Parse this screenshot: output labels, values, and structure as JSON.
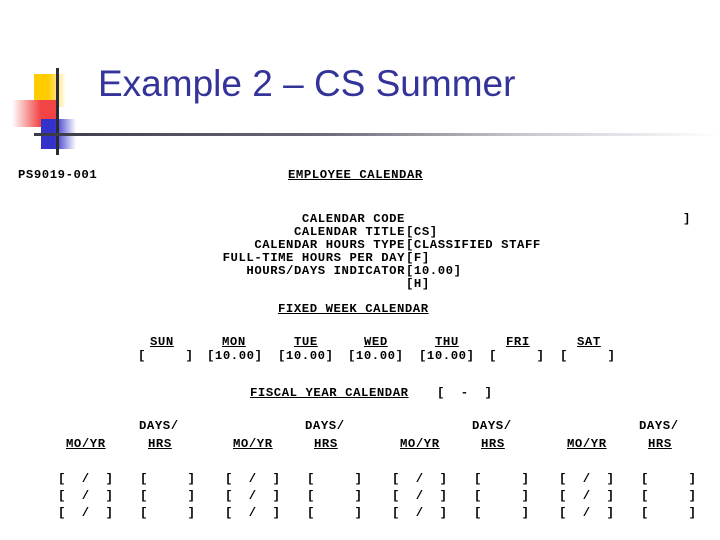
{
  "slide": {
    "title": "Example 2 – CS Summer",
    "title_color": "#333399",
    "decor": {
      "yellow": "#FFCC00",
      "red": "#F24444",
      "blue": "#3333CC",
      "rule": "#3a3a46"
    }
  },
  "terminal": {
    "screen_id": "PS9019-001",
    "heading": "EMPLOYEE CALENDAR",
    "fields": [
      {
        "label": "CALENDAR CODE",
        "value": "[CS]"
      },
      {
        "label": "CALENDAR TITLE",
        "value": "[CLASSIFIED STAFF"
      },
      {
        "label": "CALENDAR HOURS TYPE",
        "value": "[F]"
      },
      {
        "label": "FULL-TIME HOURS PER DAY",
        "value": "[10.00]"
      },
      {
        "label": "HOURS/DAYS INDICATOR",
        "value": "[H]"
      }
    ],
    "title_field_close": "]",
    "fixed_week": {
      "heading": "FIXED WEEK CALENDAR",
      "days": [
        "SUN",
        "MON",
        "TUE",
        "WED",
        "THU",
        "FRI",
        "SAT"
      ],
      "values": [
        "[     ]",
        "[10.00]",
        "[10.00]",
        "[10.00]",
        "[10.00]",
        "[     ]",
        "[     ]"
      ]
    },
    "fiscal_year": {
      "heading": "FISCAL YEAR CALENDAR",
      "range": "[  -  ]",
      "col_head_top": "DAYS/",
      "col_head_moyr": "MO/YR",
      "col_head_hrs": "HRS",
      "groups": 4,
      "rows": [
        {
          "moyr": "[  /  ]",
          "hrs": "[     ]"
        },
        {
          "moyr": "[  /  ]",
          "hrs": "[     ]"
        },
        {
          "moyr": "[  /  ]",
          "hrs": "[     ]"
        }
      ]
    }
  }
}
